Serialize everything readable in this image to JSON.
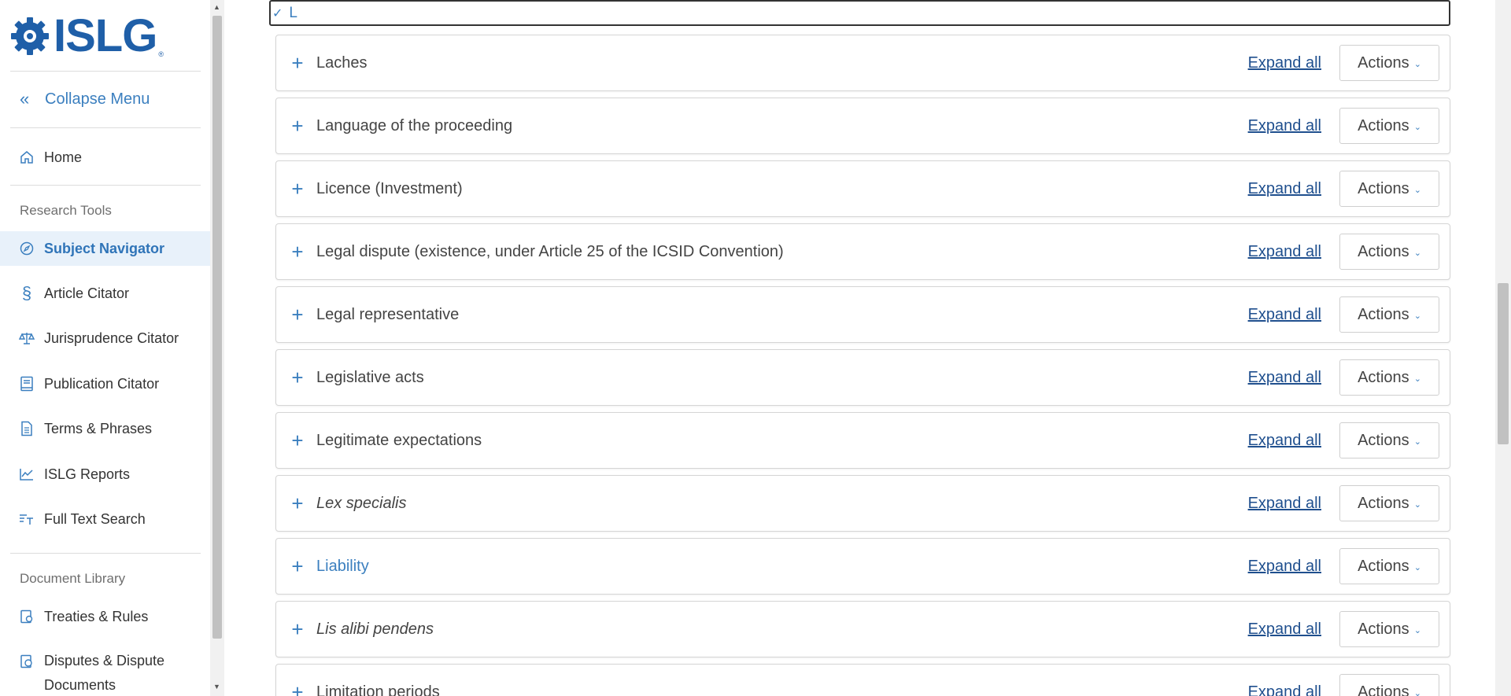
{
  "logo": {
    "text": "ISLG",
    "reg": "®"
  },
  "sidebar": {
    "collapse_label": "Collapse Menu",
    "home_label": "Home",
    "research_tools_label": "Research Tools",
    "research_items": [
      {
        "label": "Subject Navigator",
        "icon": "compass-icon"
      },
      {
        "label": "Article Citator",
        "icon": "section-icon"
      },
      {
        "label": "Jurisprudence Citator",
        "icon": "scales-icon"
      },
      {
        "label": "Publication Citator",
        "icon": "book-icon"
      },
      {
        "label": "Terms & Phrases",
        "icon": "document-icon"
      },
      {
        "label": "ISLG Reports",
        "icon": "chart-line-icon"
      },
      {
        "label": "Full Text Search",
        "icon": "text-search-icon"
      }
    ],
    "document_library_label": "Document Library",
    "library_items": [
      {
        "label": "Treaties & Rules",
        "icon": "treaty-icon"
      },
      {
        "label": "Disputes & Dispute Documents",
        "icon": "dispute-icon"
      }
    ]
  },
  "group": {
    "letter": "L"
  },
  "rows": [
    {
      "title": "Laches",
      "style": "normal"
    },
    {
      "title": "Language of the proceeding",
      "style": "normal"
    },
    {
      "title": "Licence (Investment)",
      "style": "normal"
    },
    {
      "title": "Legal dispute (existence, under Article 25 of the ICSID Convention)",
      "style": "normal"
    },
    {
      "title": "Legal representative",
      "style": "normal"
    },
    {
      "title": "Legislative acts",
      "style": "normal"
    },
    {
      "title": "Legitimate expectations",
      "style": "normal"
    },
    {
      "title": "Lex specialis",
      "style": "italic"
    },
    {
      "title": "Liability",
      "style": "link"
    },
    {
      "title": "Lis alibi pendens",
      "style": "italic"
    },
    {
      "title": "Limitation periods",
      "style": "normal"
    }
  ],
  "row_controls": {
    "expand_label": "Expand all",
    "actions_label": "Actions",
    "plus": "+"
  }
}
